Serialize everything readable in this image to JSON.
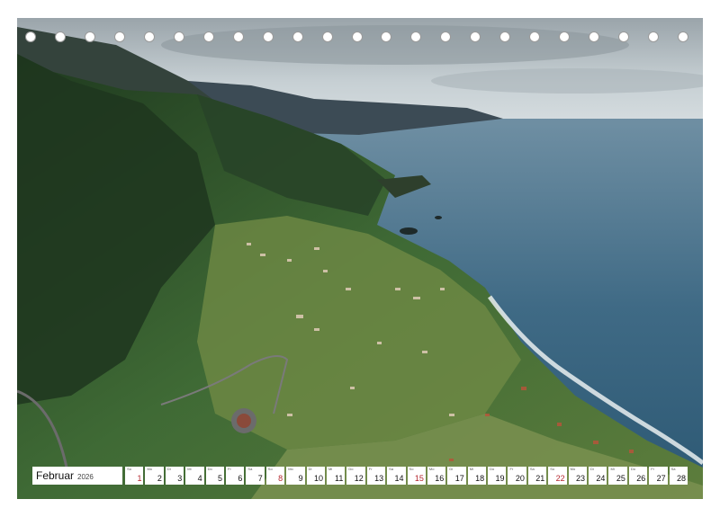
{
  "calendar": {
    "month": "Februar",
    "year": "2026",
    "days": [
      {
        "num": "1",
        "wd": "So",
        "sunday": true
      },
      {
        "num": "2",
        "wd": "Mo",
        "sunday": false
      },
      {
        "num": "3",
        "wd": "Di",
        "sunday": false
      },
      {
        "num": "4",
        "wd": "Mi",
        "sunday": false
      },
      {
        "num": "5",
        "wd": "Do",
        "sunday": false
      },
      {
        "num": "6",
        "wd": "Fr",
        "sunday": false
      },
      {
        "num": "7",
        "wd": "Sa",
        "sunday": false
      },
      {
        "num": "8",
        "wd": "So",
        "sunday": true
      },
      {
        "num": "9",
        "wd": "Mo",
        "sunday": false
      },
      {
        "num": "10",
        "wd": "Di",
        "sunday": false
      },
      {
        "num": "11",
        "wd": "Mi",
        "sunday": false
      },
      {
        "num": "12",
        "wd": "Do",
        "sunday": false
      },
      {
        "num": "13",
        "wd": "Fr",
        "sunday": false
      },
      {
        "num": "14",
        "wd": "Sa",
        "sunday": false
      },
      {
        "num": "15",
        "wd": "So",
        "sunday": true
      },
      {
        "num": "16",
        "wd": "Mo",
        "sunday": false
      },
      {
        "num": "17",
        "wd": "Di",
        "sunday": false
      },
      {
        "num": "18",
        "wd": "Mi",
        "sunday": false
      },
      {
        "num": "19",
        "wd": "Do",
        "sunday": false
      },
      {
        "num": "20",
        "wd": "Fr",
        "sunday": false
      },
      {
        "num": "21",
        "wd": "Sa",
        "sunday": false
      },
      {
        "num": "22",
        "wd": "So",
        "sunday": true
      },
      {
        "num": "23",
        "wd": "Mo",
        "sunday": false
      },
      {
        "num": "24",
        "wd": "Di",
        "sunday": false
      },
      {
        "num": "25",
        "wd": "Mi",
        "sunday": false
      },
      {
        "num": "26",
        "wd": "Do",
        "sunday": false
      },
      {
        "num": "27",
        "wd": "Fr",
        "sunday": false
      },
      {
        "num": "28",
        "wd": "Sa",
        "sunday": false
      }
    ]
  },
  "colors": {
    "sunday": "#b3262d",
    "sky": "#b9c3c8",
    "sea": "#3f6a85",
    "mountain": "#2f4a2c",
    "surf": "#e9eef0"
  },
  "binding": {
    "hole_count": 23
  }
}
